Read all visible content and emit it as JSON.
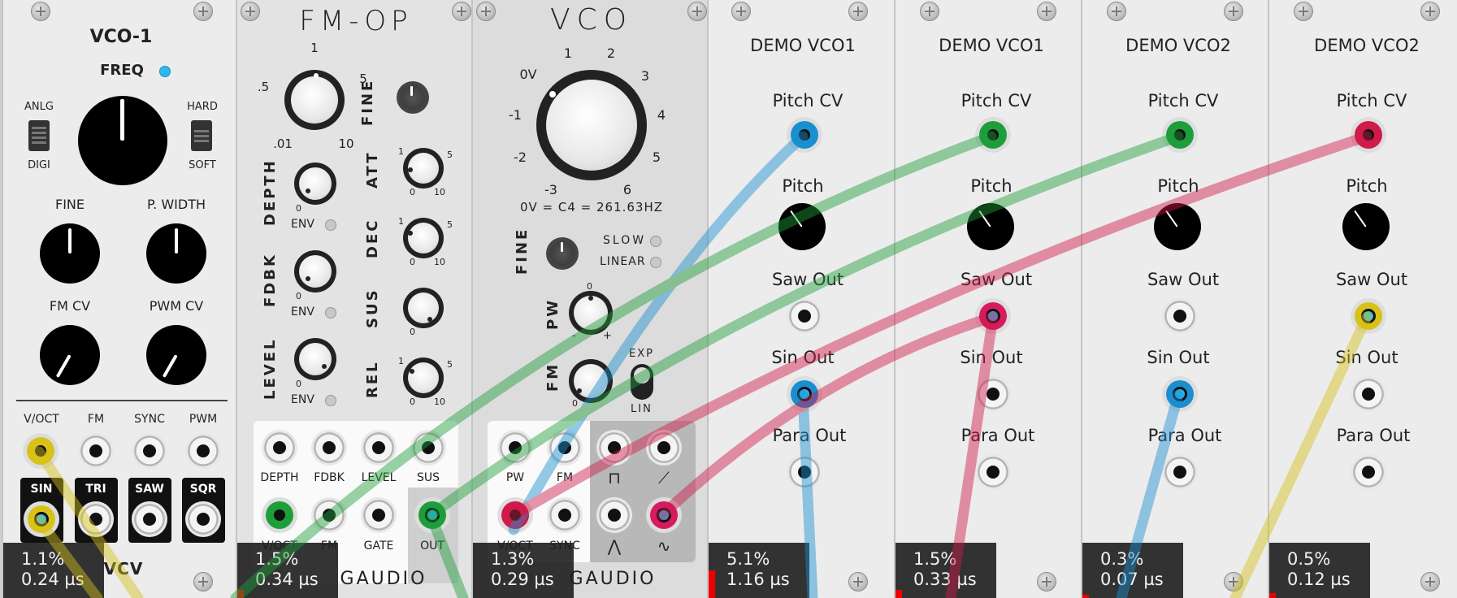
{
  "vco1": {
    "title": "VCO-1",
    "freq_label": "FREQ",
    "anlg": "ANLG",
    "digi": "DIGI",
    "hard": "HARD",
    "soft": "SOFT",
    "fine": "FINE",
    "pwidth": "P. WIDTH",
    "fmcv": "FM CV",
    "pwmcv": "PWM CV",
    "voct": "V/OCT",
    "fm": "FM",
    "sync": "SYNC",
    "pwm": "PWM",
    "sin": "SIN",
    "tri": "TRI",
    "saw": "SAW",
    "sqr": "SQR",
    "logo": "VCV",
    "cpu": "1.1%",
    "time": "0.24 µs"
  },
  "fmop": {
    "title": "FM-OP",
    "ratio_t": "1",
    "ratio_5": "5",
    "ratio_10": "10",
    "ratio_01": ".01",
    "ratio_05": ".5",
    "fine": "FINE",
    "depth": "DEPTH",
    "fdbk": "FDBK",
    "level": "LEVEL",
    "env": "ENV",
    "att": "ATT",
    "dec": "DEC",
    "sus": "SUS",
    "rel": "REL",
    "one": "1",
    "five": "5",
    "zero": "0",
    "ten": "10",
    "j_depth": "DEPTH",
    "j_fdbk": "FDBK",
    "j_level": "LEVEL",
    "j_sus": "SUS",
    "j_voct": "V/OCT",
    "j_fm": "FM",
    "j_gate": "GATE",
    "j_out": "OUT",
    "brand": "GAUDIO",
    "cpu": "1.5%",
    "time": "0.34 µs"
  },
  "vco": {
    "title": "VCO",
    "c4": "0V = C4 = 261.63HZ",
    "fine": "FINE",
    "slow": "SLOW",
    "linear": "LINEAR",
    "pw": "PW",
    "fm": "FM",
    "exp": "EXP",
    "lin": "LIN",
    "minus": "-",
    "plus": "+",
    "zero": "0",
    "ticks": [
      "0V",
      "1",
      "2",
      "3",
      "4",
      "5",
      "6",
      "-3",
      "-2",
      "-1"
    ],
    "j_pw": "PW",
    "j_fm": "FM",
    "j_voct": "V/OCT",
    "j_sync": "SYNC",
    "brand": "GAUDIO",
    "cpu": "1.3%",
    "time": "0.29 µs"
  },
  "demos": [
    {
      "title": "DEMO VCO1",
      "pitch_cv": "Pitch CV",
      "pitch": "Pitch",
      "saw": "Saw Out",
      "sin": "Sin Out",
      "para": "Para Out",
      "cpu": "5.1%",
      "time": "1.16 µs"
    },
    {
      "title": "DEMO VCO1",
      "pitch_cv": "Pitch CV",
      "pitch": "Pitch",
      "saw": "Saw Out",
      "sin": "Sin Out",
      "para": "Para Out",
      "cpu": "1.5%",
      "time": "0.33 µs"
    },
    {
      "title": "DEMO VCO2",
      "pitch_cv": "Pitch CV",
      "pitch": "Pitch",
      "saw": "Saw Out",
      "sin": "Sin Out",
      "para": "Para Out",
      "cpu": "0.3%",
      "time": "0.07 µs"
    },
    {
      "title": "DEMO VCO2",
      "pitch_cv": "Pitch CV",
      "pitch": "Pitch",
      "saw": "Saw Out",
      "sin": "Sin Out",
      "para": "Para Out",
      "cpu": "0.5%",
      "time": "0.12 µs"
    }
  ],
  "colors": {
    "blue": "#1a8fd0",
    "green": "#1e9e3a",
    "red": "#d01a4a",
    "yellow": "#d8c21a",
    "pink": "#d81a60",
    "led": "#2fb8f0"
  }
}
